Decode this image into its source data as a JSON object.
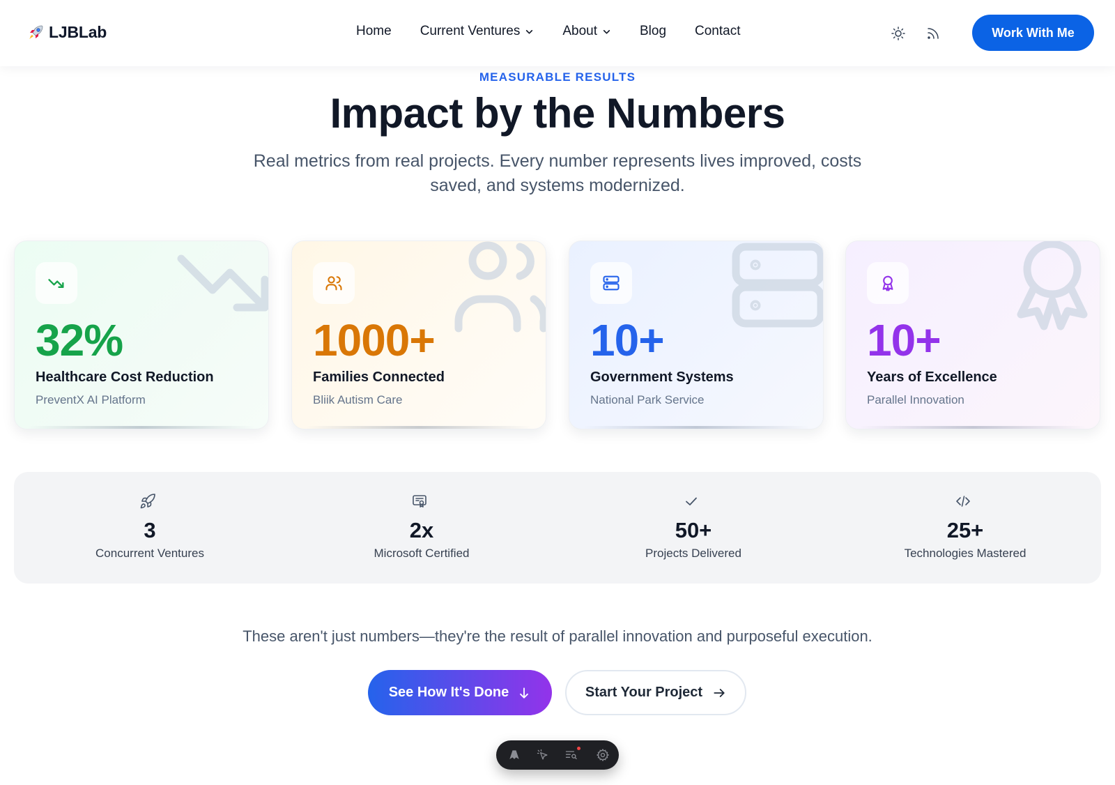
{
  "header": {
    "logo_text": "LJBLab",
    "nav": [
      {
        "label": "Home",
        "has_dropdown": false
      },
      {
        "label": "Current Ventures",
        "has_dropdown": true
      },
      {
        "label": "About",
        "has_dropdown": true
      },
      {
        "label": "Blog",
        "has_dropdown": false
      },
      {
        "label": "Contact",
        "has_dropdown": false
      }
    ],
    "icons": [
      "sun-icon",
      "rss-icon"
    ],
    "cta_label": "Work With Me",
    "cta_color": "#0b63e5"
  },
  "intro": {
    "eyebrow": "MEASURABLE RESULTS",
    "title": "Impact by the Numbers",
    "subtitle": "Real metrics from real projects. Every number represents lives improved, costs saved, and systems modernized."
  },
  "cards": [
    {
      "value": "32%",
      "label": "Healthcare Cost Reduction",
      "source": "PreventX AI Platform",
      "icon": "trending-down-icon",
      "color": "#16a34a"
    },
    {
      "value": "1000+",
      "label": "Families Connected",
      "source": "Bliik Autism Care",
      "icon": "users-icon",
      "color": "#d97706"
    },
    {
      "value": "10+",
      "label": "Government Systems",
      "source": "National Park Service",
      "icon": "server-icon",
      "color": "#2563eb"
    },
    {
      "value": "10+",
      "label": "Years of Excellence",
      "source": "Parallel Innovation",
      "icon": "award-icon",
      "color": "#9333ea"
    }
  ],
  "stats": [
    {
      "value": "3",
      "label": "Concurrent Ventures",
      "icon": "rocket-icon"
    },
    {
      "value": "2x",
      "label": "Microsoft Certified",
      "icon": "certificate-icon"
    },
    {
      "value": "50+",
      "label": "Projects Delivered",
      "icon": "check-icon"
    },
    {
      "value": "25+",
      "label": "Technologies Mastered",
      "icon": "code-icon"
    }
  ],
  "tagline": "These aren't just numbers—they're the result of parallel innovation and purposeful execution.",
  "buttons": {
    "primary": "See How It's Done",
    "secondary": "Start Your Project"
  },
  "toolbar": {
    "icons": [
      "astro-icon",
      "inspect-icon",
      "audit-icon",
      "settings-icon"
    ]
  }
}
